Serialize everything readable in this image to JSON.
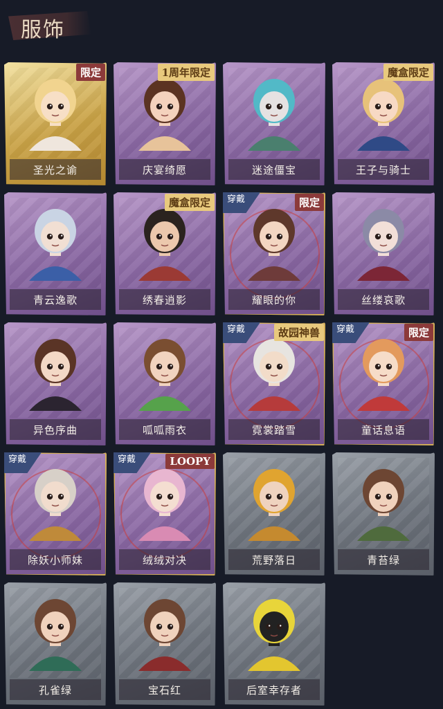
{
  "header": {
    "title": "服饰"
  },
  "items": [
    {
      "name": "圣光之谕",
      "tag": "限定",
      "tag_style": "red",
      "rarity": "gold",
      "worn": false,
      "hair": "#f1d48f",
      "skin": "#f7dfc6",
      "outfit": "#efe6dd"
    },
    {
      "name": "庆宴绮愿",
      "tag": "1周年限定",
      "tag_style": "gold",
      "rarity": "purple",
      "worn": false,
      "hair": "#5b3322",
      "skin": "#f4d2bd",
      "outfit": "#e7c39a"
    },
    {
      "name": "迷途僵宝",
      "tag": "",
      "tag_style": "",
      "rarity": "purple",
      "worn": false,
      "hair": "#52b9c7",
      "skin": "#e6e2e2",
      "outfit": "#4a7f6e"
    },
    {
      "name": "王子与骑士",
      "tag": "魔盒限定",
      "tag_style": "gold",
      "rarity": "purple",
      "worn": false,
      "hair": "#e7c27a",
      "skin": "#f7d9c4",
      "outfit": "#2f4a86"
    },
    {
      "name": "青云逸歌",
      "tag": "",
      "tag_style": "",
      "rarity": "purple",
      "worn": false,
      "hair": "#c9d4e4",
      "skin": "#f1dfd3",
      "outfit": "#3b5fa7"
    },
    {
      "name": "绣春逍影",
      "tag": "魔盒限定",
      "tag_style": "gold",
      "rarity": "purple",
      "worn": false,
      "hair": "#2b231f",
      "skin": "#ecc8ad",
      "outfit": "#9b3a34"
    },
    {
      "name": "耀眼的你",
      "tag": "限定",
      "tag_style": "red",
      "rarity": "purple",
      "worn": true,
      "hair": "#5e382b",
      "skin": "#f3d6c2",
      "outfit": "#6e3b3a"
    },
    {
      "name": "丝缕哀歌",
      "tag": "",
      "tag_style": "",
      "rarity": "purple",
      "worn": false,
      "hair": "#8b8aa6",
      "skin": "#f2dfd8",
      "outfit": "#7c2636"
    },
    {
      "name": "异色序曲",
      "tag": "",
      "tag_style": "",
      "rarity": "purple",
      "worn": false,
      "hair": "#5a3426",
      "skin": "#f3d8c6",
      "outfit": "#2b2430"
    },
    {
      "name": "呱呱雨衣",
      "tag": "",
      "tag_style": "",
      "rarity": "purple",
      "worn": false,
      "hair": "#7a4e31",
      "skin": "#f1d3bf",
      "outfit": "#56a24b"
    },
    {
      "name": "霓裳踏雪",
      "tag": "故园神兽",
      "tag_style": "gold",
      "rarity": "purple",
      "worn": true,
      "hair": "#e7e4e0",
      "skin": "#f2dcc9",
      "outfit": "#b63b3b"
    },
    {
      "name": "童话息语",
      "tag": "限定",
      "tag_style": "red",
      "rarity": "purple",
      "worn": true,
      "hair": "#e39a5d",
      "skin": "#f6dcc8",
      "outfit": "#c03a3a"
    },
    {
      "name": "除妖小师妹",
      "tag": "",
      "tag_style": "",
      "rarity": "purple",
      "worn": true,
      "hair": "#d7d0c8",
      "skin": "#f1dccd",
      "outfit": "#bf8a3a"
    },
    {
      "name": "绒绒对决",
      "tag": "LOOPY",
      "tag_style": "red",
      "rarity": "purple",
      "worn": true,
      "hair": "#e8b6d0",
      "skin": "#f4ded1",
      "outfit": "#d98bb3"
    },
    {
      "name": "荒野落日",
      "tag": "",
      "tag_style": "",
      "rarity": "grey",
      "worn": false,
      "hair": "#e0a430",
      "skin": "#efd3bf",
      "outfit": "#c58a2f"
    },
    {
      "name": "青苔绿",
      "tag": "",
      "tag_style": "",
      "rarity": "grey",
      "worn": false,
      "hair": "#6d4633",
      "skin": "#f0d2bd",
      "outfit": "#4f6b3d"
    },
    {
      "name": "孔雀绿",
      "tag": "",
      "tag_style": "",
      "rarity": "grey",
      "worn": false,
      "hair": "#6d4633",
      "skin": "#f0d2bd",
      "outfit": "#2f6c57"
    },
    {
      "name": "宝石红",
      "tag": "",
      "tag_style": "",
      "rarity": "grey",
      "worn": false,
      "hair": "#6d4633",
      "skin": "#f0d2bd",
      "outfit": "#8a2c2c"
    },
    {
      "name": "后室幸存者",
      "tag": "",
      "tag_style": "",
      "rarity": "grey",
      "worn": false,
      "hair": "#e8d53a",
      "skin": "#222222",
      "outfit": "#e3c62f"
    }
  ],
  "worn_label": "穿戴"
}
